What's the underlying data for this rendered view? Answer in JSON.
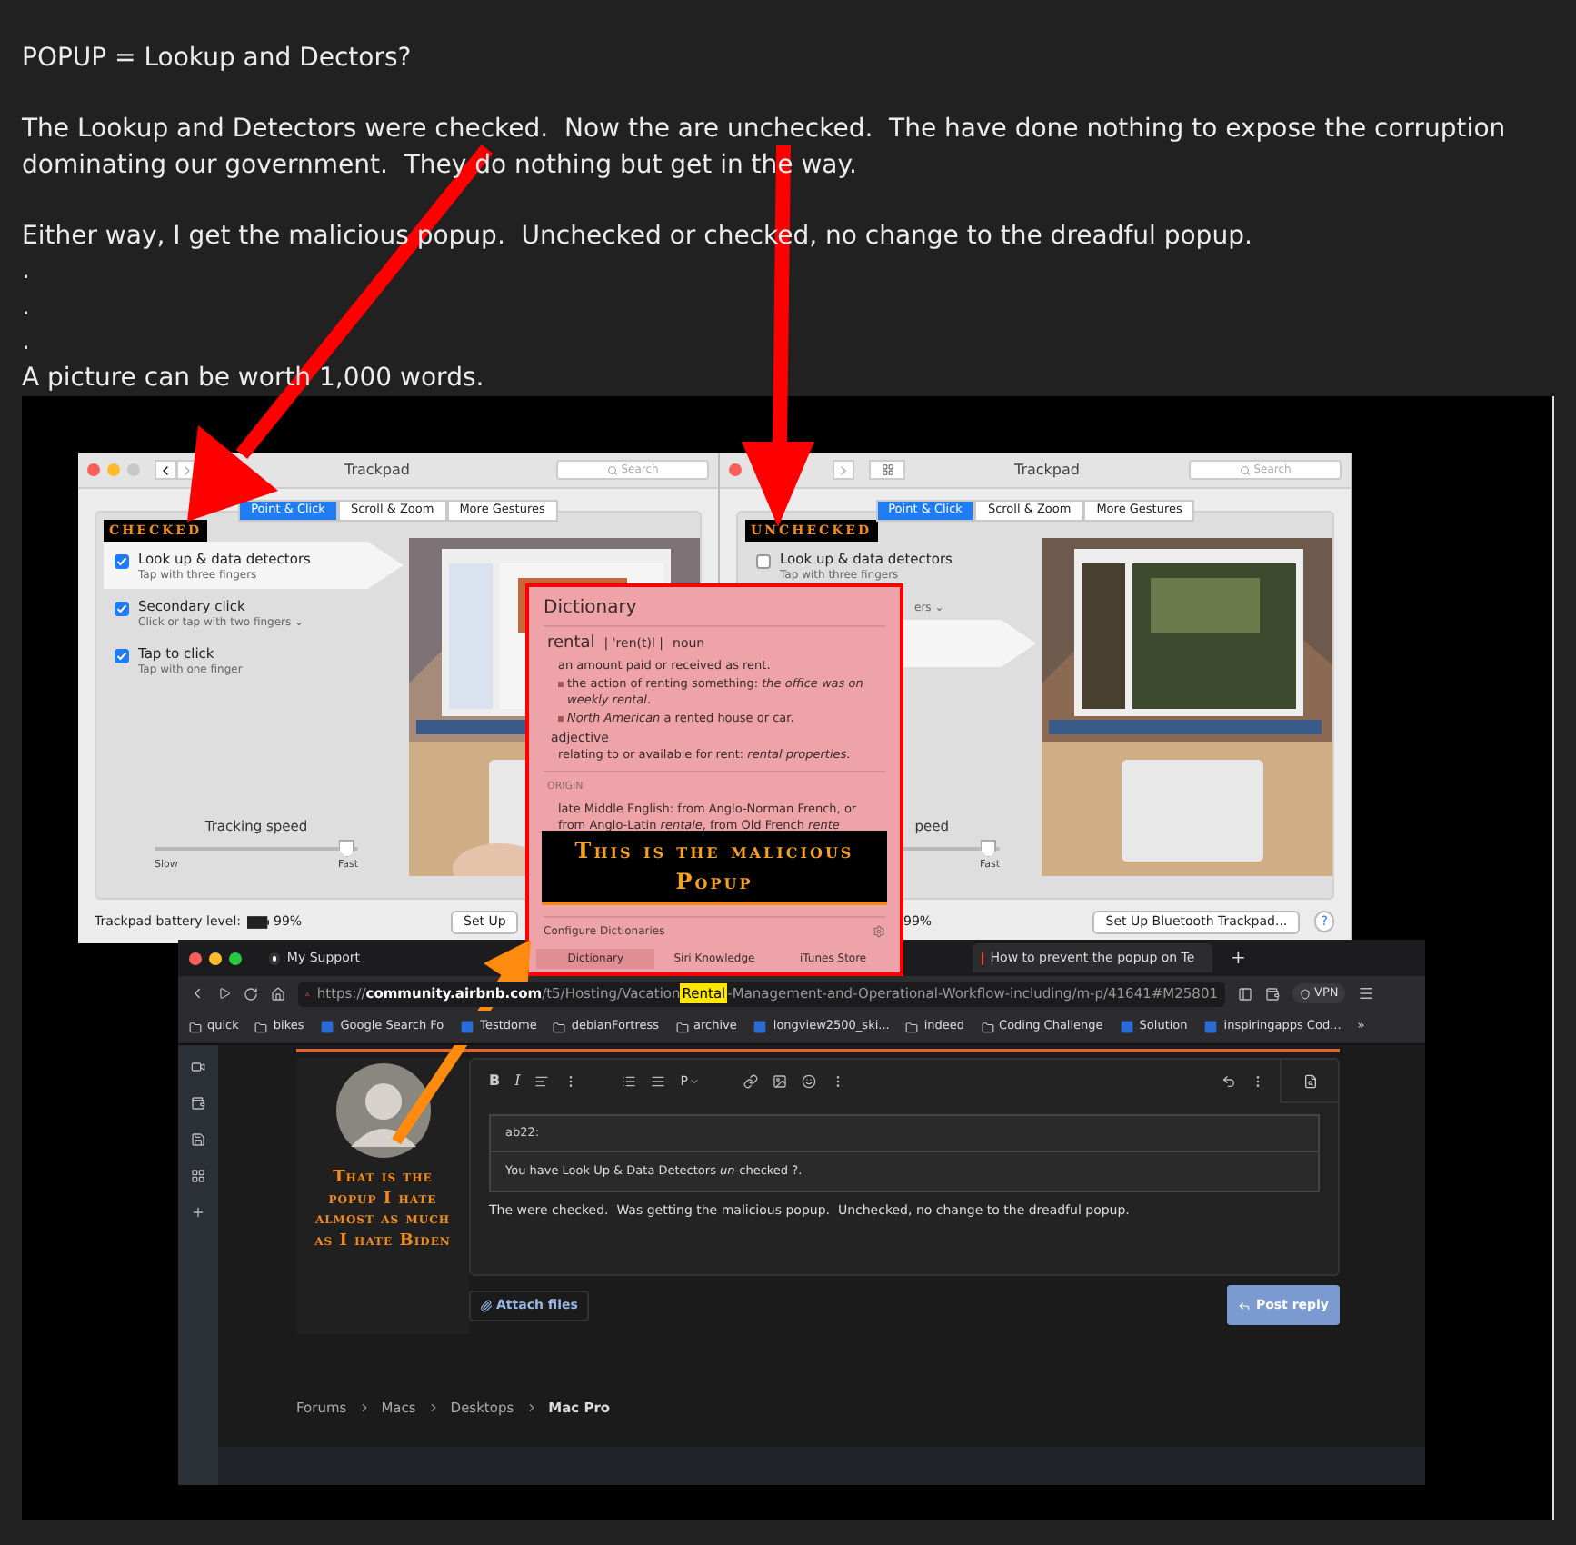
{
  "post": {
    "blocks": [
      [
        "POPUP = Lookup and Dectors?"
      ],
      [
        "The Lookup and Detectors were checked.  Now the are unchecked.  The have done nothing to expose the corruption dominating our government.  They do nothing but get in the way."
      ],
      [
        "Either way, I get the malicious popup.  Unchecked or checked, no change to the dreadful popup.",
        ".",
        ".",
        ".",
        "A picture can be worth 1,000 words."
      ]
    ]
  },
  "trackpad_windows": [
    {
      "title": "Trackpad",
      "search_placeholder": "Search",
      "tabs": [
        {
          "label": "Point & Click",
          "selected": true
        },
        {
          "label": "Scroll & Zoom",
          "selected": false
        },
        {
          "label": "More Gestures",
          "selected": false
        }
      ],
      "tag": "CHECKED",
      "options": [
        {
          "title": "Look up & data detectors",
          "subtitle": "Tap with three fingers",
          "checked": true,
          "highlighted": true
        },
        {
          "title": "Secondary click",
          "subtitle": "Click or tap with two fingers ⌄",
          "checked": true,
          "highlighted": false
        },
        {
          "title": "Tap to click",
          "subtitle": "Tap with one finger",
          "checked": true,
          "highlighted": false
        }
      ],
      "tracking": {
        "label": "Tracking speed",
        "level": 0.95,
        "slow": "Slow",
        "fast": "Fast"
      },
      "battery_label": "Trackpad battery level:",
      "battery_value": "99%",
      "setup_button": "Set Up"
    },
    {
      "title": "Trackpad",
      "search_placeholder": "Search",
      "tabs": [
        {
          "label": "Point & Click",
          "selected": true
        },
        {
          "label": "Scroll & Zoom",
          "selected": false
        },
        {
          "label": "More Gestures",
          "selected": false
        }
      ],
      "tag": "UNCHECKED",
      "options": [
        {
          "title": "Look up & data detectors",
          "subtitle": "Tap with three fingers",
          "checked": false,
          "highlighted": false
        }
      ],
      "fragment": "ers ⌄",
      "highlight_row": true,
      "tracking": {
        "label": "peed",
        "level": 0.95,
        "fast": "Fast"
      },
      "battery_value": "99%",
      "setup_button": "Set Up Bluetooth Trackpad...",
      "help": "?"
    }
  ],
  "popup": {
    "title": "Dictionary",
    "headword": "rental",
    "pronunciation": "| ˈren(t)l |",
    "pos": "noun",
    "senses": [
      {
        "kind": "plain",
        "text": "an amount paid or received as rent."
      },
      {
        "kind": "bullet",
        "text": "the action of renting something: *the office was on weekly rental*."
      },
      {
        "kind": "bullet",
        "text": "*North American* a rented house or car."
      }
    ],
    "pos2": "adjective",
    "sense2": "relating to or available for rent: *rental properties*.",
    "origin_label": "ORIGIN",
    "origin": "late Middle English: from Anglo-Norman French, or from Anglo-Latin *rentale*, from Old French *rente*",
    "label": "This is the malicious Popup",
    "configure": "Configure Dictionaries",
    "tabs": [
      {
        "label": "Dictionary",
        "selected": true
      },
      {
        "label": "Siri Knowledge",
        "selected": false
      },
      {
        "label": "iTunes Store",
        "selected": false
      }
    ]
  },
  "browser": {
    "tabs": [
      {
        "label": "My Support",
        "selected": false
      },
      {
        "label": "How to prevent the popup on Te",
        "selected": true
      }
    ],
    "new_tab": "+",
    "url": {
      "before": "https://**community.airbnb.com**/t5/Hosting/Vacation",
      "highlight": "Rental",
      "after": "-Management-and-Operational-Workflow-including/m-p/41641#M25801"
    },
    "vpn": "VPN",
    "bookmarks": [
      {
        "kind": "folder",
        "label": "quick"
      },
      {
        "kind": "folder",
        "label": "bikes"
      },
      {
        "kind": "page",
        "label": "Google Search Fo"
      },
      {
        "kind": "page",
        "label": "Testdome"
      },
      {
        "kind": "folder",
        "label": "debianFortress"
      },
      {
        "kind": "folder",
        "label": "archive"
      },
      {
        "kind": "page",
        "label": "longview2500_ski..."
      },
      {
        "kind": "folder",
        "label": "indeed"
      },
      {
        "kind": "folder",
        "label": "Coding Challenge"
      },
      {
        "kind": "page",
        "label": "Solution"
      },
      {
        "kind": "page",
        "label": "inspiringapps Cod..."
      },
      {
        "kind": "more",
        "label": "»"
      }
    ],
    "caption": "That is the popup I hate almost as much as I hate Biden",
    "toolbar_letters": [
      "B",
      "I",
      "P"
    ],
    "quote_author": "ab22:",
    "quote_text": "You have Look Up & Data Detectors *un*-checked ?.",
    "reply_text": "The were checked.  Was getting the malicious popup.  Unchecked, no change to the dreadful popup.",
    "attach_button": "Attach files",
    "post_button": "Post reply",
    "breadcrumb": [
      {
        "label": "Forums",
        "current": false
      },
      {
        "label": "Macs",
        "current": false
      },
      {
        "label": "Desktops",
        "current": false
      },
      {
        "label": "Mac Pro",
        "current": true
      }
    ]
  }
}
